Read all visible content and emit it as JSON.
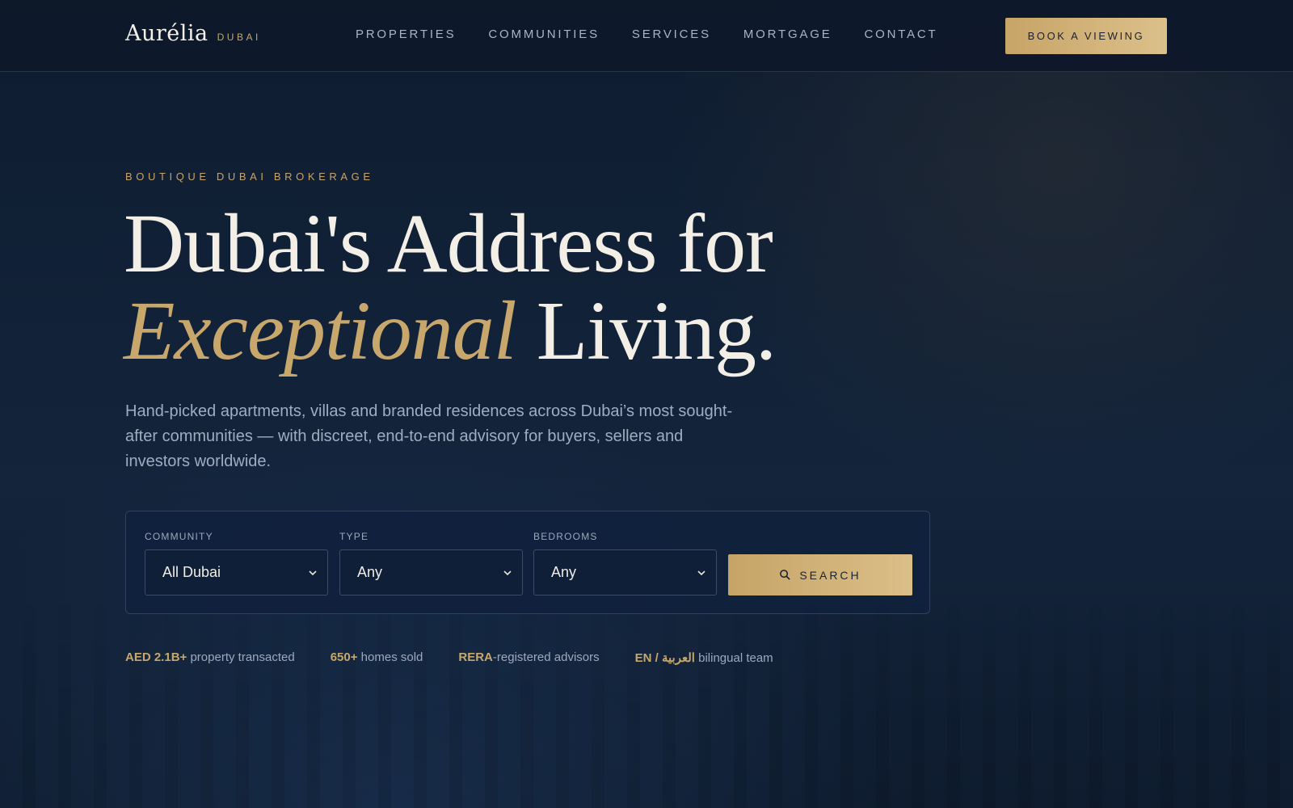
{
  "colors": {
    "navy": "#0d1a2d",
    "gold": "#c8a76c",
    "cream": "#f3efe6",
    "muted": "#9fadc1"
  },
  "header": {
    "logo_word": "Aurélia",
    "logo_sub": "DUBAI",
    "nav": [
      "PROPERTIES",
      "COMMUNITIES",
      "SERVICES",
      "MORTGAGE",
      "CONTACT"
    ],
    "cta_label": "BOOK A VIEWING"
  },
  "hero": {
    "eyebrow": "BOUTIQUE DUBAI BROKERAGE",
    "headline_line1": "Dubai's Address for",
    "headline_accent": "Exceptional",
    "headline_line2_rest": " Living.",
    "lead": "Hand-picked apartments, villas and branded residences across Dubai’s most sought-after communities — with discreet, end-to-end advisory for buyers, sellers and investors worldwide."
  },
  "search": {
    "community": {
      "label": "COMMUNITY",
      "value": "All Dubai"
    },
    "type": {
      "label": "TYPE",
      "value": "Any"
    },
    "bedrooms": {
      "label": "BEDROOMS",
      "value": "Any"
    },
    "button_label": "SEARCH",
    "button_icon": "search-icon",
    "chevron_icon": "chevron-down-icon"
  },
  "stats": [
    {
      "strong": "AED 2.1B+",
      "rest": " property transacted"
    },
    {
      "strong": "650+",
      "rest": " homes sold"
    },
    {
      "strong": "RERA",
      "rest": "-registered advisors"
    },
    {
      "strong": "EN / العربية",
      "rest": " bilingual team"
    }
  ]
}
